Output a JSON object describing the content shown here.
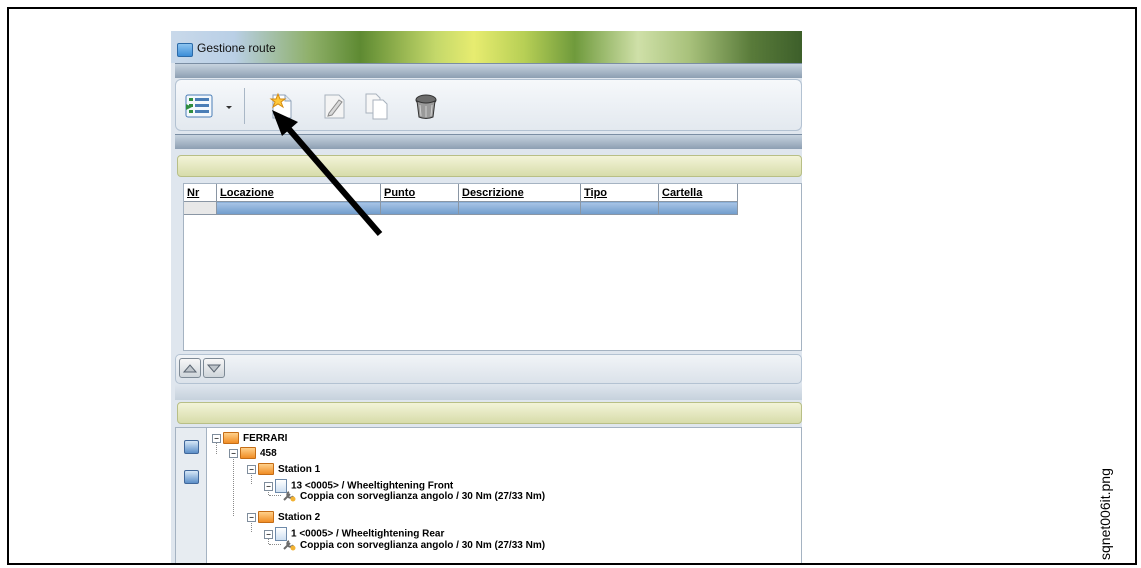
{
  "window": {
    "title": "Gestione route"
  },
  "toolbar": {
    "buttons": [
      {
        "icon": "list-view-icon",
        "has_dropdown": true
      },
      {
        "icon": "new-star-document-icon"
      },
      {
        "icon": "edit-pencil-icon"
      },
      {
        "icon": "copy-documents-icon"
      },
      {
        "icon": "trash-bin-icon"
      }
    ]
  },
  "grid": {
    "columns": [
      "Nr",
      "Locazione",
      "Punto",
      "Descrizione",
      "Tipo",
      "Cartella"
    ],
    "rows": []
  },
  "tree": {
    "root": "FERRARI",
    "model": "458",
    "stations": [
      {
        "label": "Station 1",
        "route": "13 <0005> / Wheeltightening Front",
        "step": "Coppia con sorveglianza angolo / 30 Nm (27/33 Nm)"
      },
      {
        "label": "Station 2",
        "route": "1 <0005> / Wheeltightening Rear",
        "step": "Coppia con sorveglianza angolo / 30 Nm (27/33 Nm)"
      }
    ]
  },
  "image_caption": "sqnet006it.png",
  "colors": {
    "arrow": "#000000",
    "folder": "#f08d25",
    "grid_row": "#7fa6d2"
  }
}
